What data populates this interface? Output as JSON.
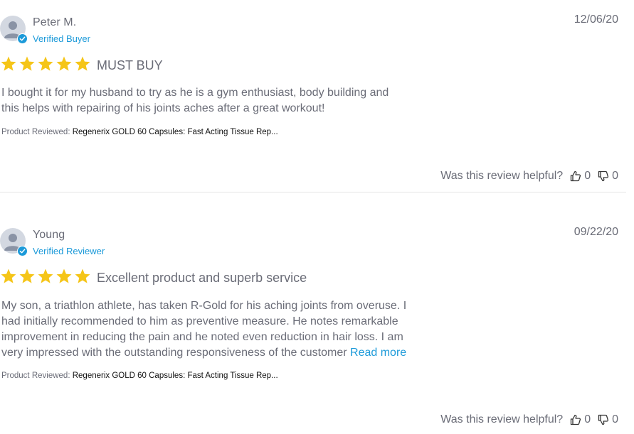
{
  "reviews": [
    {
      "author": "Peter M.",
      "badge": "Verified Buyer",
      "date": "12/06/20",
      "rating": 5,
      "title": "MUST BUY",
      "content": "I bought it for my husband to try as he is a gym enthusiast, body building and this helps with repairing of his joints aches after a great workout!",
      "read_more": "",
      "product_label": "Product Reviewed:",
      "product_name": "Regenerix GOLD 60 Capsules: Fast Acting Tissue Rep...",
      "helpful_label": "Was this review helpful?",
      "votes_up": "0",
      "votes_down": "0"
    },
    {
      "author": "Young",
      "badge": "Verified Reviewer",
      "date": "09/22/20",
      "rating": 5,
      "title": "Excellent product and superb service",
      "content": "My son, a triathlon athlete, has taken R-Gold for his aching joints from overuse. I had initially recommended to him as preventive measure. He notes remarkable improvement in reducing the pain and he noted even reduction in hair loss. I am very impressed with the outstanding responsiveness of the customer",
      "read_more": "Read more",
      "product_label": "Product Reviewed:",
      "product_name": "Regenerix GOLD 60 Capsules: Fast Acting Tissue Rep...",
      "helpful_label": "Was this review helpful?",
      "votes_up": "0",
      "votes_down": "0"
    }
  ],
  "colors": {
    "star": "#f5c518",
    "accent": "#1c9ad9",
    "text": "#6a6c77",
    "divider": "#e6e6e6",
    "avatar_bg": "#d3d8e1"
  },
  "icons": {
    "avatar": "user-silhouette-icon",
    "verified": "checkmark-badge-icon",
    "star": "star-icon",
    "vote_up": "thumbs-up-icon",
    "vote_down": "thumbs-down-icon"
  }
}
